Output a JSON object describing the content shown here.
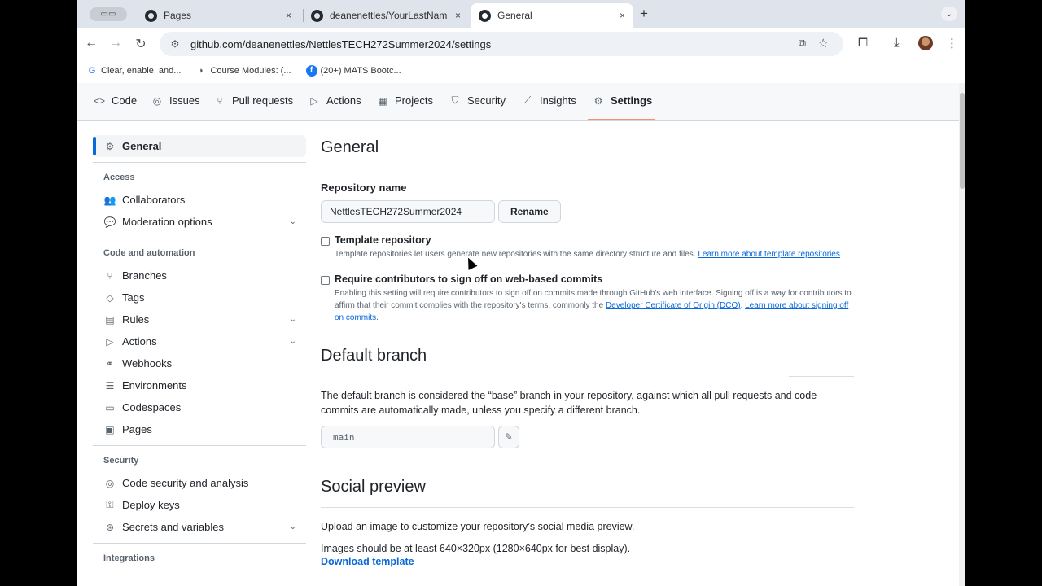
{
  "browser": {
    "tabs": [
      {
        "title": "Pages",
        "active": false
      },
      {
        "title": "deanenettles/YourLastNameT",
        "active": false
      },
      {
        "title": "General",
        "active": true
      }
    ],
    "close_glyph": "×",
    "new_tab_glyph": "+",
    "url": "github.com/deanenettles/NettlesTECH272Summer2024/settings",
    "bookmarks": [
      {
        "label": "Clear, enable, and...",
        "icon": "google-icon"
      },
      {
        "label": "Course Modules: (...",
        "icon": "canvas-icon"
      },
      {
        "label": "(20+) MATS Bootc...",
        "icon": "facebook-icon"
      }
    ]
  },
  "repo_nav": {
    "items": [
      {
        "label": "Code",
        "icon": "code-icon"
      },
      {
        "label": "Issues",
        "icon": "issue-icon"
      },
      {
        "label": "Pull requests",
        "icon": "pull-request-icon"
      },
      {
        "label": "Actions",
        "icon": "play-icon"
      },
      {
        "label": "Projects",
        "icon": "table-icon"
      },
      {
        "label": "Security",
        "icon": "shield-icon"
      },
      {
        "label": "Insights",
        "icon": "graph-icon"
      },
      {
        "label": "Settings",
        "icon": "gear-icon"
      }
    ],
    "active": "Settings"
  },
  "sidebar": {
    "general": "General",
    "access_heading": "Access",
    "collaborators": "Collaborators",
    "moderation": "Moderation options",
    "code_heading": "Code and automation",
    "branches": "Branches",
    "tags": "Tags",
    "rules": "Rules",
    "actions": "Actions",
    "webhooks": "Webhooks",
    "environments": "Environments",
    "codespaces": "Codespaces",
    "pages": "Pages",
    "security_heading": "Security",
    "code_security": "Code security and analysis",
    "deploy_keys": "Deploy keys",
    "secrets": "Secrets and variables",
    "integrations_heading": "Integrations"
  },
  "main": {
    "title": "General",
    "repo_name_label": "Repository name",
    "repo_name_value": "NettlesTECH272Summer2024",
    "rename_label": "Rename",
    "template": {
      "title": "Template repository",
      "desc": "Template repositories let users generate new repositories with the same directory structure and files.",
      "link": "Learn more about template repositories",
      "end": "."
    },
    "signoff": {
      "title": "Require contributors to sign off on web-based commits",
      "desc": "Enabling this setting will require contributors to sign off on commits made through GitHub's web interface. Signing off is a way for contributors to affirm that their commit complies with the repository's terms, commonly the",
      "link1": "Developer Certificate of Origin (DCO)",
      "mid": ".",
      "link2": "Learn more about signing off on commits",
      "end": "."
    },
    "default_branch": {
      "title": "Default branch",
      "desc": "The default branch is considered the “base” branch in your repository, against which all pull requests and code commits are automatically made, unless you specify a different branch.",
      "value": "main"
    },
    "social_preview": {
      "title": "Social preview",
      "desc1": "Upload an image to customize your repository’s social media preview.",
      "desc2": "Images should be at least 640×320px (1280×640px for best display).",
      "download": "Download template"
    }
  }
}
